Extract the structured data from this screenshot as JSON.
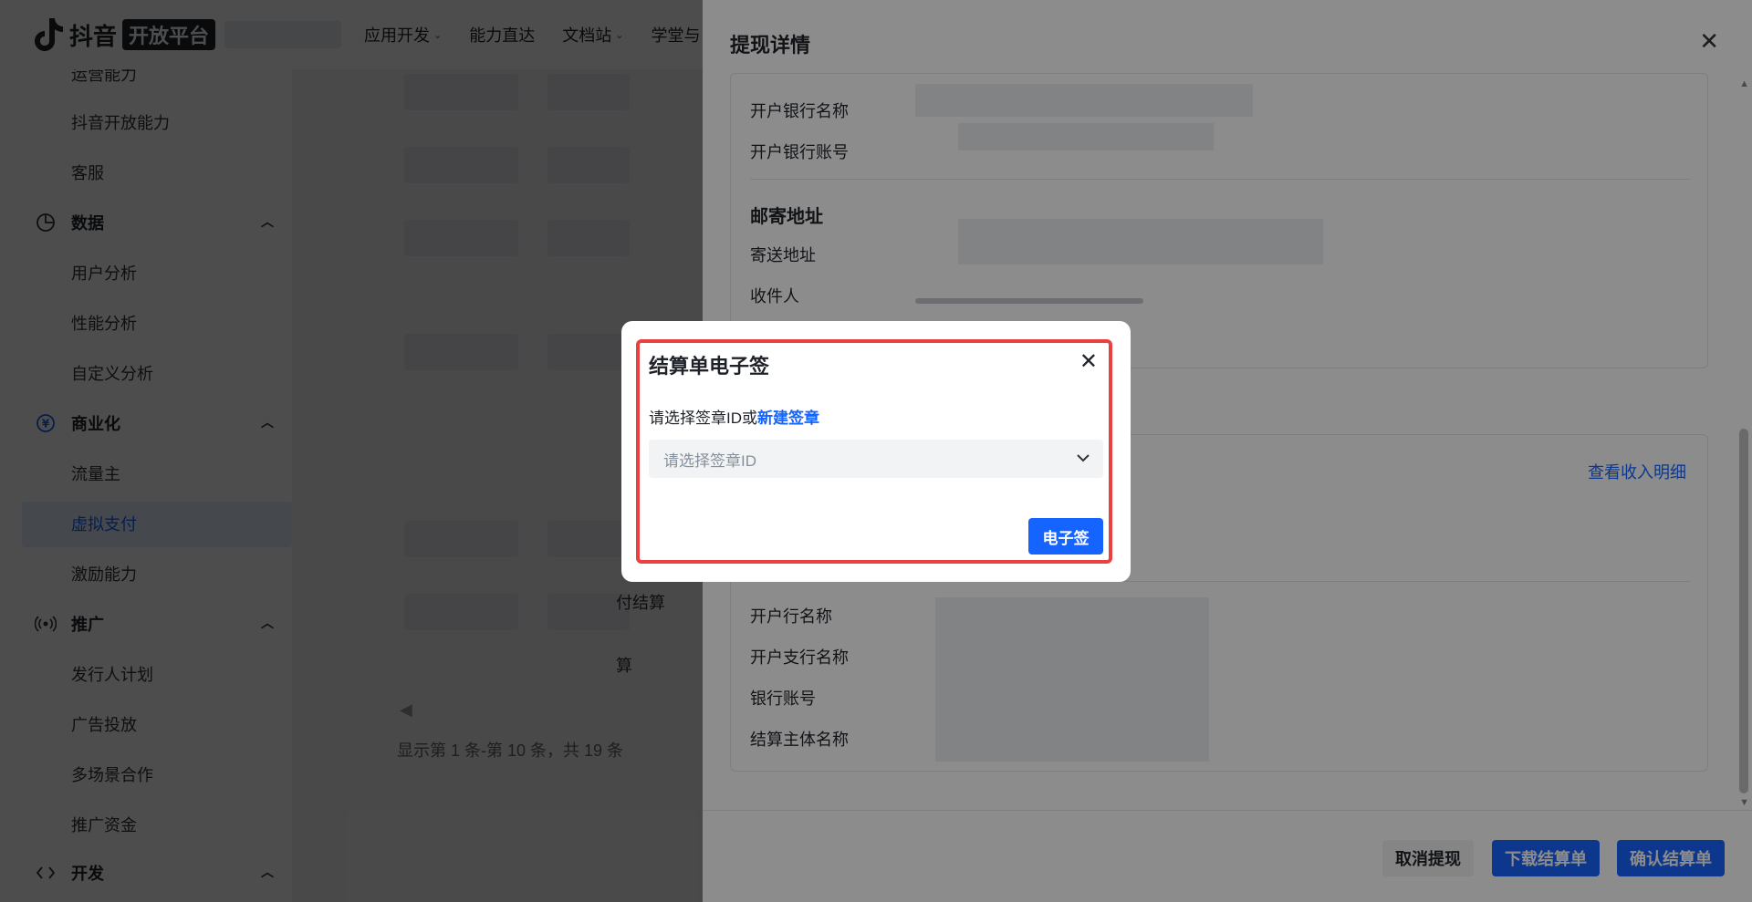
{
  "header": {
    "logo_text": "抖音",
    "logo_badge": "开放平台",
    "nav": [
      {
        "label": "应用开发",
        "has_dropdown": true
      },
      {
        "label": "能力直达",
        "has_dropdown": false
      },
      {
        "label": "文档站",
        "has_dropdown": true
      },
      {
        "label": "学堂与",
        "has_dropdown": false
      }
    ]
  },
  "sidebar": {
    "items_top": [
      "运营能力",
      "抖音开放能力",
      "客服"
    ],
    "groups": [
      {
        "label": "数据",
        "icon": "pie-chart-icon",
        "items": [
          "用户分析",
          "性能分析",
          "自定义分析"
        ]
      },
      {
        "label": "商业化",
        "icon": "yuan-icon",
        "items": [
          "流量主",
          "虚拟支付",
          "激励能力"
        ]
      },
      {
        "label": "推广",
        "icon": "broadcast-icon",
        "items": [
          "发行人计划",
          "广告投放",
          "多场景合作",
          "推广资金"
        ]
      },
      {
        "label": "开发",
        "icon": "code-icon",
        "items": []
      }
    ],
    "active_item": "虚拟支付"
  },
  "main": {
    "partial_texts": [
      "付结算",
      "算"
    ],
    "pagination_text": "显示第 1 条-第 10 条，共 19 条"
  },
  "drawer": {
    "title": "提现详情",
    "close_icon": "close-icon",
    "fields_bank_top": [
      "开户银行名称",
      "开户银行账号"
    ],
    "mail_section_title": "邮寄地址",
    "fields_mail": [
      "寄送地址",
      "收件人"
    ],
    "income_link": "查看收入明细",
    "fields_bank_bottom": [
      "开户行名称",
      "开户支行名称",
      "银行账号",
      "结算主体名称"
    ],
    "buttons": {
      "cancel": "取消提现",
      "download": "下载结算单",
      "confirm": "确认结算单"
    }
  },
  "modal": {
    "title": "结算单电子签",
    "prompt_prefix": "请选择签章ID或",
    "prompt_link": "新建签章",
    "select_placeholder": "请选择签章ID",
    "submit_label": "电子签",
    "highlight_color": "#e8413f"
  },
  "colors": {
    "primary": "#1664ff",
    "highlight": "#e8413f"
  }
}
